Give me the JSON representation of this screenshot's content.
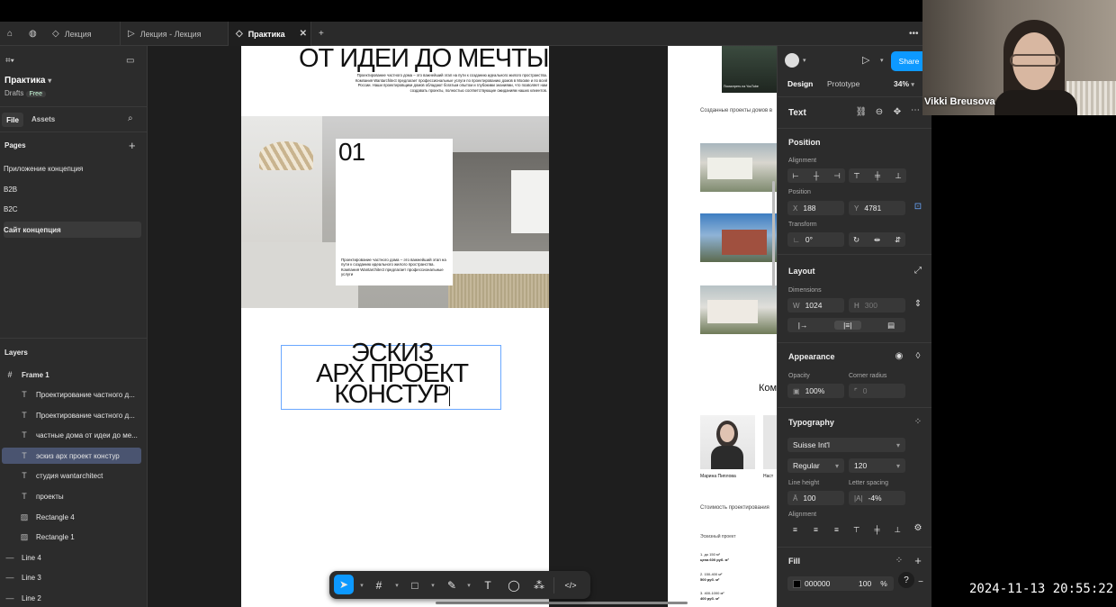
{
  "tabs": [
    {
      "label": "Лекция"
    },
    {
      "label": "Лекция - Лекция"
    },
    {
      "label": "Практика"
    }
  ],
  "file": {
    "name": "Практика",
    "location": "Drafts",
    "plan": "Free"
  },
  "left_tabs": {
    "file": "File",
    "assets": "Assets"
  },
  "pages": {
    "title": "Pages",
    "items": [
      "Приложение концепция",
      "B2B",
      "B2C",
      "Сайт концепция"
    ]
  },
  "layers": {
    "title": "Layers",
    "frame": "Frame 1",
    "items": [
      "Проектирование частного д...",
      "Проектирование частного д...",
      "частные дома от идеи до ме...",
      "эскиз арх проект констур",
      "студия wantarchitect",
      "проекты",
      "Rectangle 4",
      "Rectangle 1"
    ],
    "lines": [
      "Line 4",
      "Line 3",
      "Line 2"
    ]
  },
  "canvas": {
    "headline": "ОТ ИДЕИ ДО МЕЧТЫ",
    "intro": "Проектирование частного дома – это важнейший этап на пути к созданию идеального жилого пространства. Компания Wantarchitect предлагает профессиональные услуги по проектированию домов в Москве и по всей России. Наши проектировщики домов обладают богатым опытом и глубокими знаниями, что позволяет нам создавать проекты, полностью соответствующие ожиданиям наших клиентов.",
    "card_number": "01",
    "card_text": "Проектирование частного дома – это важнейший этап на пути к созданию идеального жилого пространства. Компания Wantarchitect предлагает профессиональные услуги",
    "sketch_lines": [
      "ЭСКИЗ",
      "АРХ ПРОЕКТ",
      "КОНСТУР"
    ],
    "side_heading": "Созданные проекты домов в",
    "side_mid": "Ком",
    "person_name": "Марина Пиплова",
    "person_name2": "Наст",
    "price_title": "Стоимость проектирования",
    "sketch_project": "Эскизный проект",
    "price_rows": [
      "1. до 150 м²",
      "2. 150-400 м²",
      "3. 400-1000 м²"
    ],
    "price_vals": [
      "цена 600 руб. м²",
      "500 руб. м²",
      "400 руб. м²"
    ],
    "video_caption": "Посмотреть на YouTube"
  },
  "right": {
    "mode_tabs": {
      "design": "Design",
      "prototype": "Prototype"
    },
    "zoom": "34%",
    "share": "Share",
    "element": "Text",
    "position_title": "Position",
    "alignment_label": "Alignment",
    "position_label": "Position",
    "x_label": "X",
    "x": "188",
    "y_label": "Y",
    "y": "4781",
    "transform_label": "Transform",
    "rotation": "0°",
    "layout_title": "Layout",
    "dimensions_label": "Dimensions",
    "w_label": "W",
    "w": "1024",
    "h_label": "H",
    "h": "300",
    "appearance_title": "Appearance",
    "opacity_label": "Opacity",
    "opacity": "100%",
    "radius_label": "Corner radius",
    "radius": "0",
    "typography_title": "Typography",
    "font": "Suisse Int'l",
    "weight": "Regular",
    "size": "120",
    "line_height_label": "Line height",
    "line_height": "100",
    "letter_spacing_label": "Letter spacing",
    "letter_spacing": "-4%",
    "typo_alignment_label": "Alignment",
    "fill_title": "Fill",
    "fill_hex": "000000",
    "fill_opacity": "100",
    "fill_unit": "%",
    "help": "?"
  },
  "video": {
    "name": "Vikki Breusova"
  },
  "timestamp": "2024-11-13  20:55:22",
  "colors": {
    "accent": "#0d99ff",
    "selection": "#4a5470",
    "canvas": "#1e1e1e",
    "panel": "#2c2c2c"
  }
}
